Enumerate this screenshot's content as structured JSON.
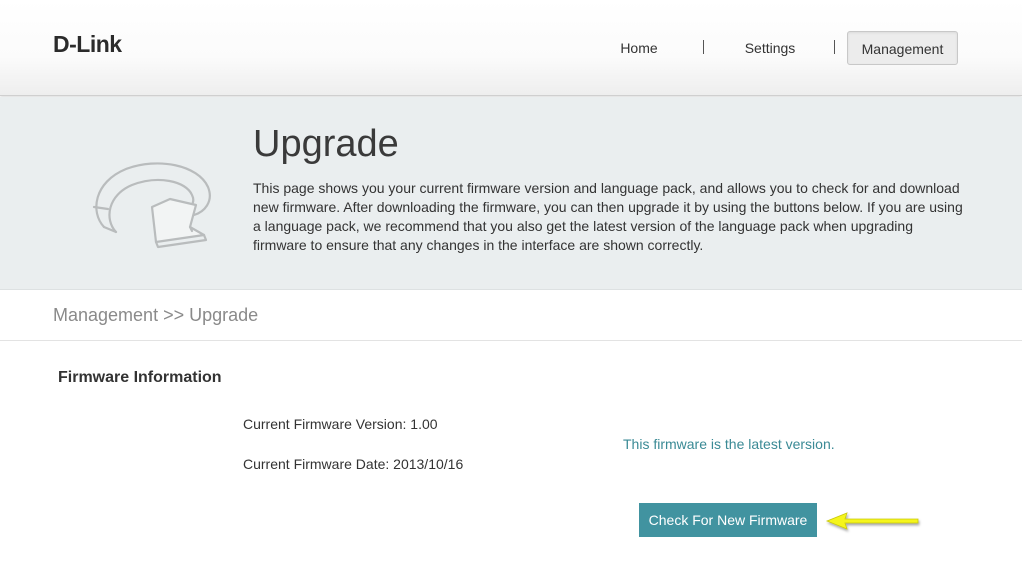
{
  "header": {
    "logo": "D-Link",
    "nav": {
      "home": "Home",
      "separator": "|",
      "settings": "Settings",
      "management": "Management"
    }
  },
  "banner": {
    "title": "Upgrade",
    "description": "This page shows you your current firmware version and language pack, and allows you to check for and download new firmware. After downloading the firmware, you can then upgrade it by using the buttons below. If you are using a language pack, we recommend that you also get the latest version of the language pack when upgrading firmware to ensure that any changes in the interface are shown correctly.",
    "icon": "upgrade-arrow-icon"
  },
  "breadcrumb": "Management >> Upgrade",
  "firmware": {
    "section_title": "Firmware Information",
    "version_label": "Current Firmware Version:",
    "version_value": "1.00",
    "date_label": "Current Firmware Date:",
    "date_value": "2013/10/16",
    "status": "This firmware is the latest version.",
    "check_button": "Check For New Firmware"
  },
  "annotation": {
    "icon": "yellow-pointer-arrow-icon",
    "color": "#f5f51e"
  },
  "colors": {
    "accent": "#4193a0",
    "status_text": "#3a8a95",
    "banner_bg": "#eaeeef"
  }
}
